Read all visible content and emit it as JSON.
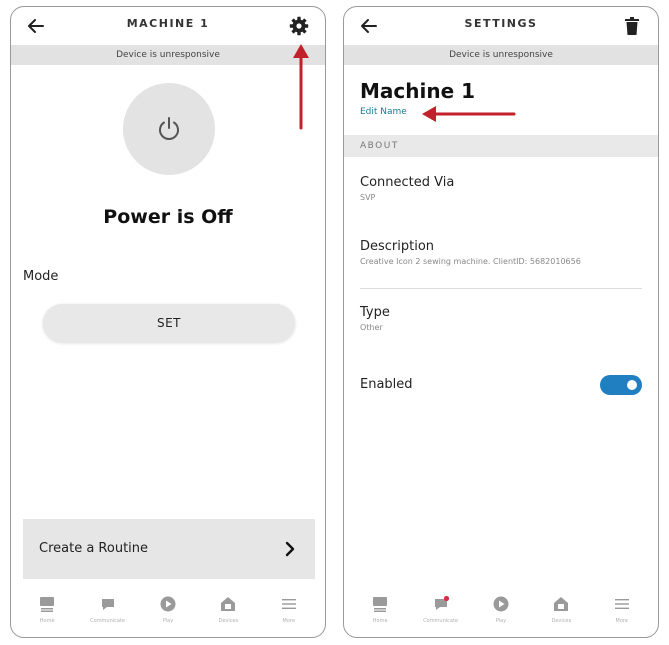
{
  "left_screen": {
    "header": {
      "title": "MACHINE 1"
    },
    "banner": "Device is unresponsive",
    "power_status": "Power is Off",
    "mode_label": "Mode",
    "set_button": "SET",
    "routine_label": "Create a Routine"
  },
  "right_screen": {
    "header": {
      "title": "SETTINGS"
    },
    "banner": "Device is unresponsive",
    "device_name": "Machine 1",
    "edit_name": "Edit Name",
    "section": "ABOUT",
    "settings": [
      {
        "key": "Connected Via",
        "value": "SVP"
      },
      {
        "key": "Description",
        "value": "Creative Icon 2 sewing machine. ClientID: 5682010656"
      },
      {
        "key": "Type",
        "value": "Other"
      }
    ],
    "enabled_label": "Enabled",
    "enabled": true
  },
  "nav": {
    "items": [
      {
        "label": "Home",
        "icon": "home-icon"
      },
      {
        "label": "Communicate",
        "icon": "communicate-icon"
      },
      {
        "label": "Play",
        "icon": "play-icon"
      },
      {
        "label": "Devices",
        "icon": "devices-icon"
      },
      {
        "label": "More",
        "icon": "more-icon"
      }
    ]
  },
  "colors": {
    "accent_link": "#1a7a96",
    "toggle_on": "#1f7fc0",
    "annotation_arrow": "#c0212b",
    "notification_dot": "#d9304a"
  }
}
